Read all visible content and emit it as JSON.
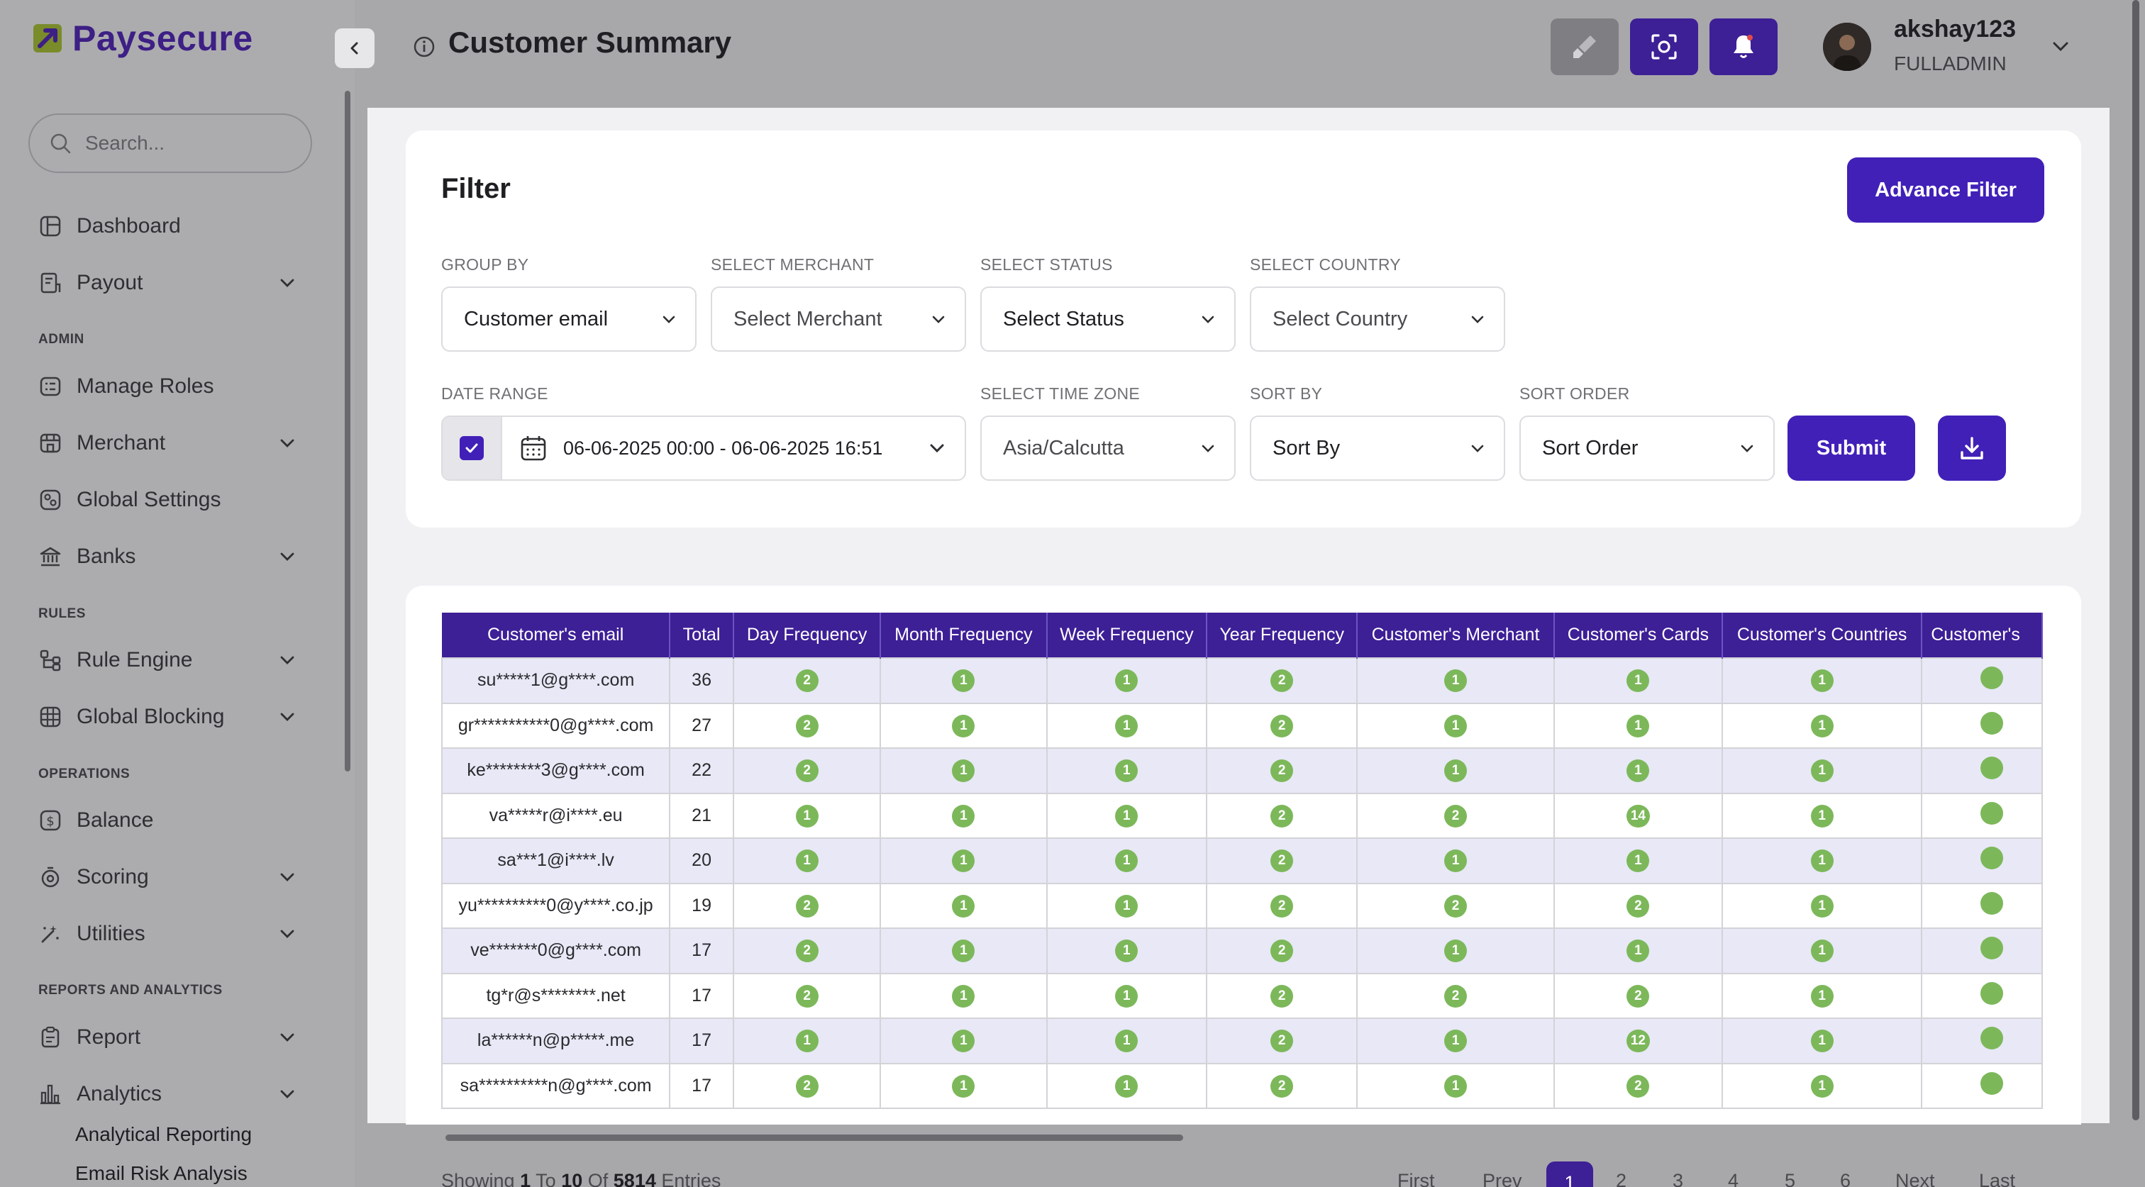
{
  "app": {
    "brand": "Paysecure"
  },
  "sidebar": {
    "search_placeholder": "Search...",
    "items": [
      {
        "label": "Dashboard",
        "icon": "dashboard-icon",
        "has_submenu": false
      },
      {
        "label": "Payout",
        "icon": "payout-icon",
        "has_submenu": true
      },
      {
        "label": "Manage Roles",
        "icon": "roles-icon",
        "has_submenu": false
      },
      {
        "label": "Merchant",
        "icon": "merchant-icon",
        "has_submenu": true
      },
      {
        "label": "Global Settings",
        "icon": "settings-icon",
        "has_submenu": false
      },
      {
        "label": "Banks",
        "icon": "bank-icon",
        "has_submenu": true
      },
      {
        "label": "Rule Engine",
        "icon": "rule-engine-icon",
        "has_submenu": true
      },
      {
        "label": "Global Blocking",
        "icon": "blocking-icon",
        "has_submenu": true
      },
      {
        "label": "Balance",
        "icon": "balance-icon",
        "has_submenu": false
      },
      {
        "label": "Scoring",
        "icon": "scoring-icon",
        "has_submenu": true
      },
      {
        "label": "Utilities",
        "icon": "utilities-icon",
        "has_submenu": true
      },
      {
        "label": "Report",
        "icon": "report-icon",
        "has_submenu": true
      },
      {
        "label": "Analytics",
        "icon": "analytics-icon",
        "has_submenu": true
      }
    ],
    "sections": [
      "ADMIN",
      "RULES",
      "OPERATIONS",
      "REPORTS AND ANALYTICS"
    ],
    "analytics_subitems": [
      "Analytical Reporting",
      "Email Risk Analysis"
    ]
  },
  "header": {
    "title": "Customer Summary",
    "user": {
      "name": "akshay123",
      "role": "FULLADMIN"
    }
  },
  "filter": {
    "title": "Filter",
    "advance_filter_label": "Advance Filter",
    "group_by": {
      "label": "GROUP BY",
      "value": "Customer email"
    },
    "merchant": {
      "label": "SELECT MERCHANT",
      "value": "Select Merchant"
    },
    "status": {
      "label": "SELECT STATUS",
      "value": "Select Status"
    },
    "country": {
      "label": "SELECT COUNTRY",
      "value": "Select Country"
    },
    "date_range": {
      "label": "DATE RANGE",
      "value": "06-06-2025 00:00 - 06-06-2025 16:51",
      "checked": true
    },
    "time_zone": {
      "label": "SELECT TIME ZONE",
      "value": "Asia/Calcutta"
    },
    "sort_by": {
      "label": "SORT BY",
      "value": "Sort By"
    },
    "sort_order": {
      "label": "SORT ORDER",
      "value": "Sort Order"
    },
    "submit_label": "Submit"
  },
  "table": {
    "columns": [
      "Customer's email",
      "Total",
      "Day Frequency",
      "Month Frequency",
      "Week Frequency",
      "Year Frequency",
      "Customer's Merchant",
      "Customer's Cards",
      "Customer's Countries",
      "Customer's"
    ],
    "rows": [
      [
        "su*****1@g****.com",
        "36",
        "2",
        "1",
        "1",
        "2",
        "1",
        "1",
        "1",
        ""
      ],
      [
        "gr***********0@g****.com",
        "27",
        "2",
        "1",
        "1",
        "2",
        "1",
        "1",
        "1",
        ""
      ],
      [
        "ke********3@g****.com",
        "22",
        "2",
        "1",
        "1",
        "2",
        "1",
        "1",
        "1",
        ""
      ],
      [
        "va*****r@i****.eu",
        "21",
        "1",
        "1",
        "1",
        "2",
        "2",
        "14",
        "1",
        ""
      ],
      [
        "sa***1@i****.lv",
        "20",
        "1",
        "1",
        "1",
        "2",
        "1",
        "1",
        "1",
        ""
      ],
      [
        "yu**********0@y****.co.jp",
        "19",
        "2",
        "1",
        "1",
        "2",
        "2",
        "2",
        "1",
        ""
      ],
      [
        "ve*******0@g****.com",
        "17",
        "2",
        "1",
        "1",
        "2",
        "1",
        "1",
        "1",
        ""
      ],
      [
        "tg*r@s********.net",
        "17",
        "2",
        "1",
        "1",
        "2",
        "2",
        "2",
        "1",
        ""
      ],
      [
        "la******n@p*****.me",
        "17",
        "1",
        "1",
        "1",
        "2",
        "1",
        "12",
        "1",
        ""
      ],
      [
        "sa**********n@g****.com",
        "17",
        "2",
        "1",
        "1",
        "2",
        "1",
        "2",
        "1",
        ""
      ]
    ]
  },
  "pagination": {
    "showing_prefix": "Showing",
    "from": "1",
    "to_word": "To",
    "to": "10",
    "of_word": "Of",
    "total": "5814",
    "suffix": "Entries",
    "first": "First",
    "prev": "Prev",
    "pages": [
      "1",
      "2",
      "3",
      "4",
      "5",
      "6"
    ],
    "current": "1",
    "next": "Next",
    "last": "Last"
  },
  "colors": {
    "brand": "#3d1f85",
    "primary": "#4120b8",
    "table_header": "#3d1f96",
    "pill_green": "#7cb85a",
    "row_alt": "#e8e8f6"
  }
}
